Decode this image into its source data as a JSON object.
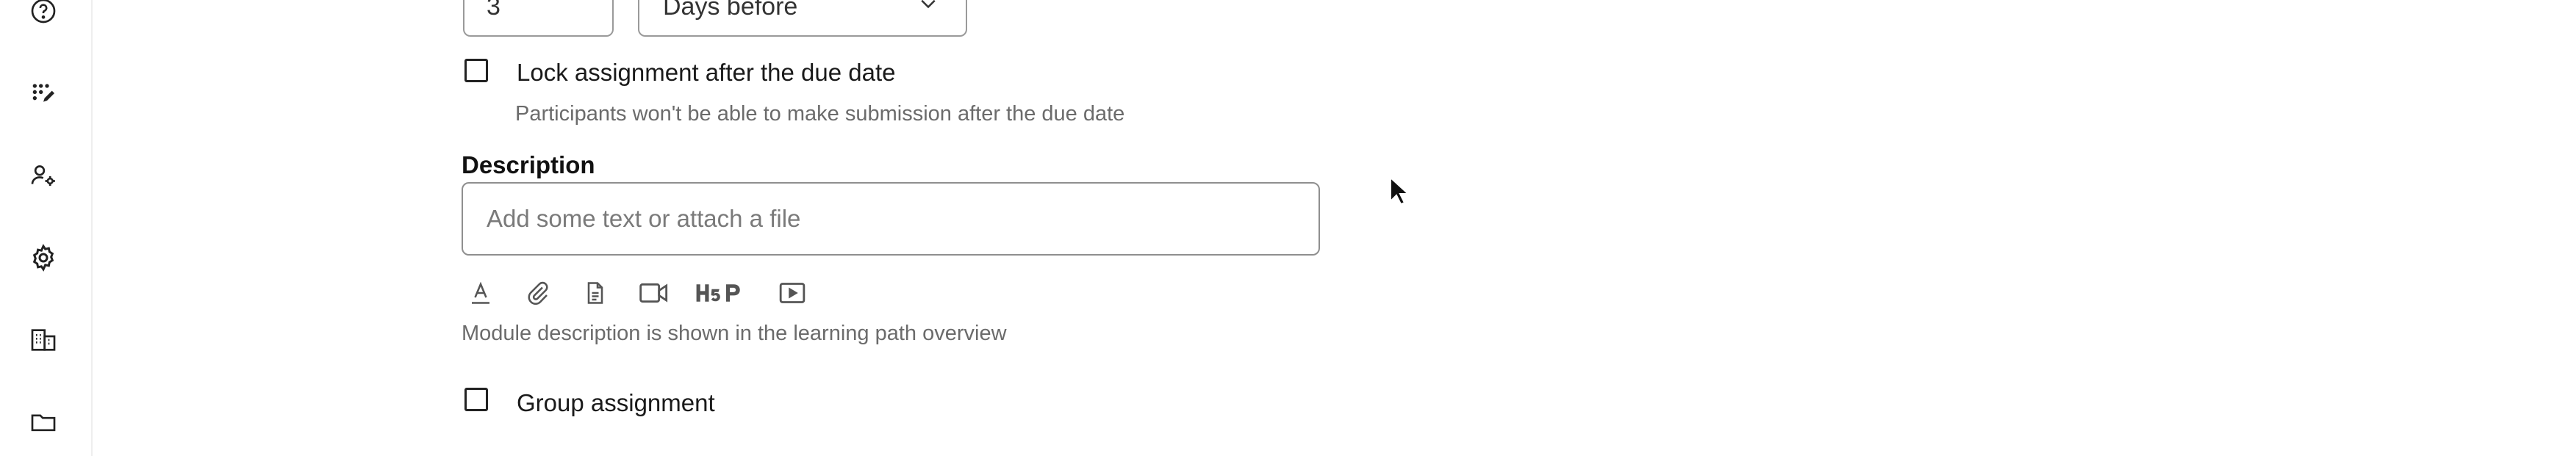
{
  "sidebar": {
    "icons": [
      {
        "name": "help-icon"
      },
      {
        "name": "edit-modules-icon"
      },
      {
        "name": "user-settings-icon"
      },
      {
        "name": "gear-icon"
      },
      {
        "name": "building-icon"
      },
      {
        "name": "folder-icon"
      }
    ]
  },
  "reminder": {
    "amount_value": "3",
    "unit_selected": "Days before"
  },
  "lock_assignment": {
    "label": "Lock assignment after the due date",
    "help": "Participants won't be able to make submission after the due date",
    "checked": false
  },
  "description": {
    "title": "Description",
    "placeholder": "Add some text or attach a file",
    "help": "Module description is shown in the learning path overview",
    "toolbar": [
      "text-format-icon",
      "attachment-icon",
      "document-icon",
      "video-icon",
      "h5p-icon",
      "youtube-icon"
    ]
  },
  "group_assignment": {
    "label": "Group assignment",
    "checked": false
  }
}
